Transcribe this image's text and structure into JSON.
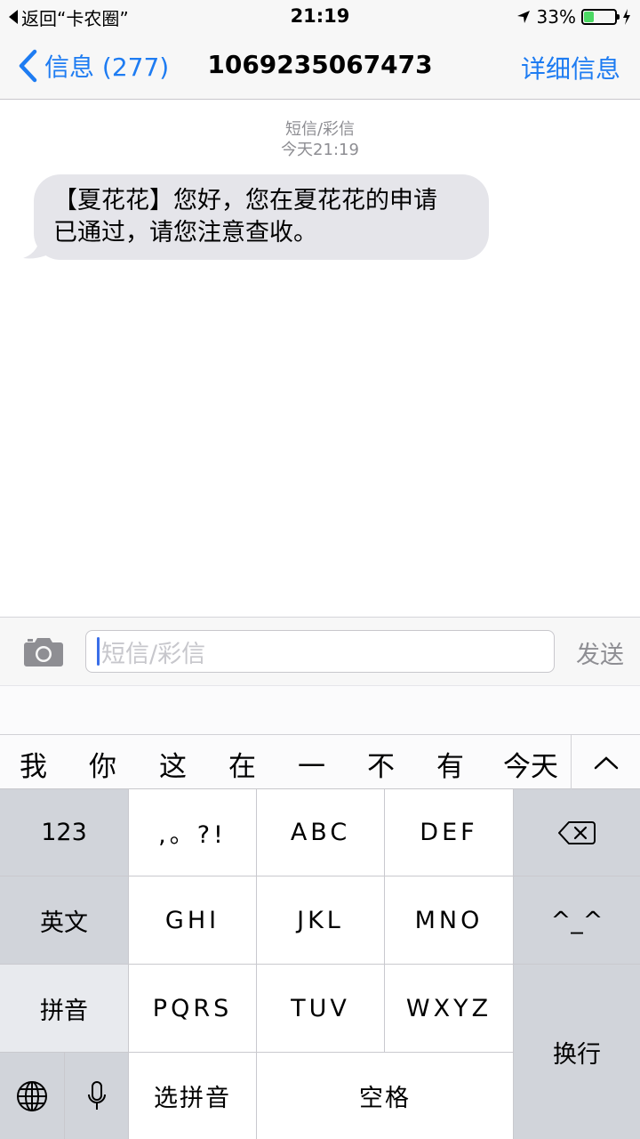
{
  "status_bar": {
    "back_label": "返回“卡农圈”",
    "time": "21:19",
    "battery": "33%",
    "battery_level": 0.33
  },
  "nav": {
    "back_label": "信息 (277)",
    "title": "1069235067473",
    "detail_label": "详细信息"
  },
  "thread": {
    "type_label": "短信/彩信",
    "timestamp": "今天21:19",
    "messages": [
      {
        "line1": "【夏花花】您好，您在夏花花的申请",
        "line2": "已通过，请您注意查收。"
      }
    ]
  },
  "composer": {
    "placeholder": "短信/彩信",
    "send_label": "发送"
  },
  "candidates": [
    "我",
    "你",
    "这",
    "在",
    "一",
    "不",
    "有",
    "今天"
  ],
  "keyboard": {
    "k123": "123",
    "punct": ",。?!",
    "abc": "ABC",
    "def": "DEF",
    "english": "英文",
    "ghi": "GHI",
    "jkl": "JKL",
    "mno": "MNO",
    "emoticon": "^_^",
    "pinyin": "拼音",
    "pqrs": "PQRS",
    "tuv": "TUV",
    "wxyz": "WXYZ",
    "return": "换行",
    "select_pinyin": "选拼音",
    "space": "空格"
  },
  "colors": {
    "accent": "#1e7cf2",
    "bubble": "#e5e5ea",
    "battery": "#4cd964"
  }
}
